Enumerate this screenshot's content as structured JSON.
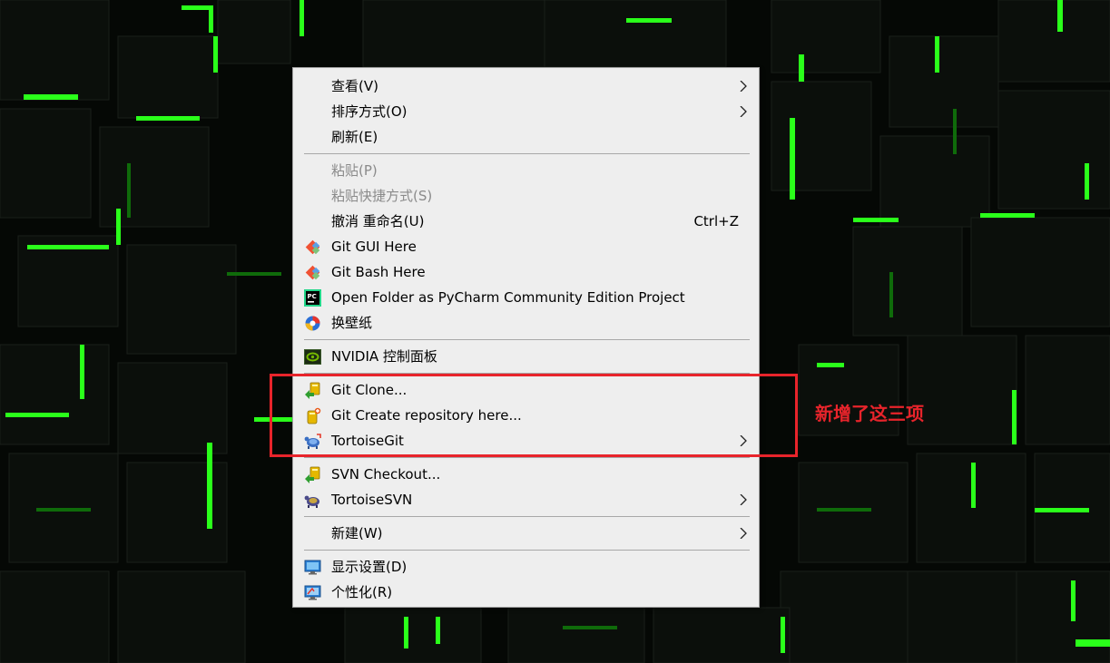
{
  "menu": {
    "items": [
      {
        "label": "查看(V)",
        "has_submenu": true
      },
      {
        "label": "排序方式(O)",
        "has_submenu": true
      },
      {
        "label": "刷新(E)"
      },
      {
        "label": "粘贴(P)",
        "disabled": true
      },
      {
        "label": "粘贴快捷方式(S)",
        "disabled": true
      },
      {
        "label": "撤消 重命名(U)",
        "shortcut": "Ctrl+Z"
      },
      {
        "label": "Git GUI Here",
        "icon": "git-gui-icon"
      },
      {
        "label": "Git Bash Here",
        "icon": "git-bash-icon"
      },
      {
        "label": "Open Folder as PyCharm Community Edition Project",
        "icon": "pycharm-icon"
      },
      {
        "label": "换壁纸",
        "icon": "wallpaper-icon"
      },
      {
        "label": "NVIDIA 控制面板",
        "icon": "nvidia-icon"
      },
      {
        "label": "Git Clone...",
        "icon": "git-clone-icon"
      },
      {
        "label": "Git Create repository here...",
        "icon": "git-create-repo-icon"
      },
      {
        "label": "TortoiseGit",
        "icon": "tortoisegit-icon",
        "has_submenu": true
      },
      {
        "label": "SVN Checkout...",
        "icon": "svn-checkout-icon"
      },
      {
        "label": "TortoiseSVN",
        "icon": "tortoisesvn-icon",
        "has_submenu": true
      },
      {
        "label": "新建(W)",
        "has_submenu": true
      },
      {
        "label": "显示设置(D)",
        "icon": "display-settings-icon"
      },
      {
        "label": "个性化(R)",
        "icon": "personalize-icon"
      }
    ]
  },
  "annotation": {
    "text": "新增了这三项",
    "color": "#e8242b"
  },
  "colors": {
    "menu_bg": "#eeeeee",
    "wallpaper_accent": "#2aff1a",
    "highlight": "#e8242b"
  }
}
